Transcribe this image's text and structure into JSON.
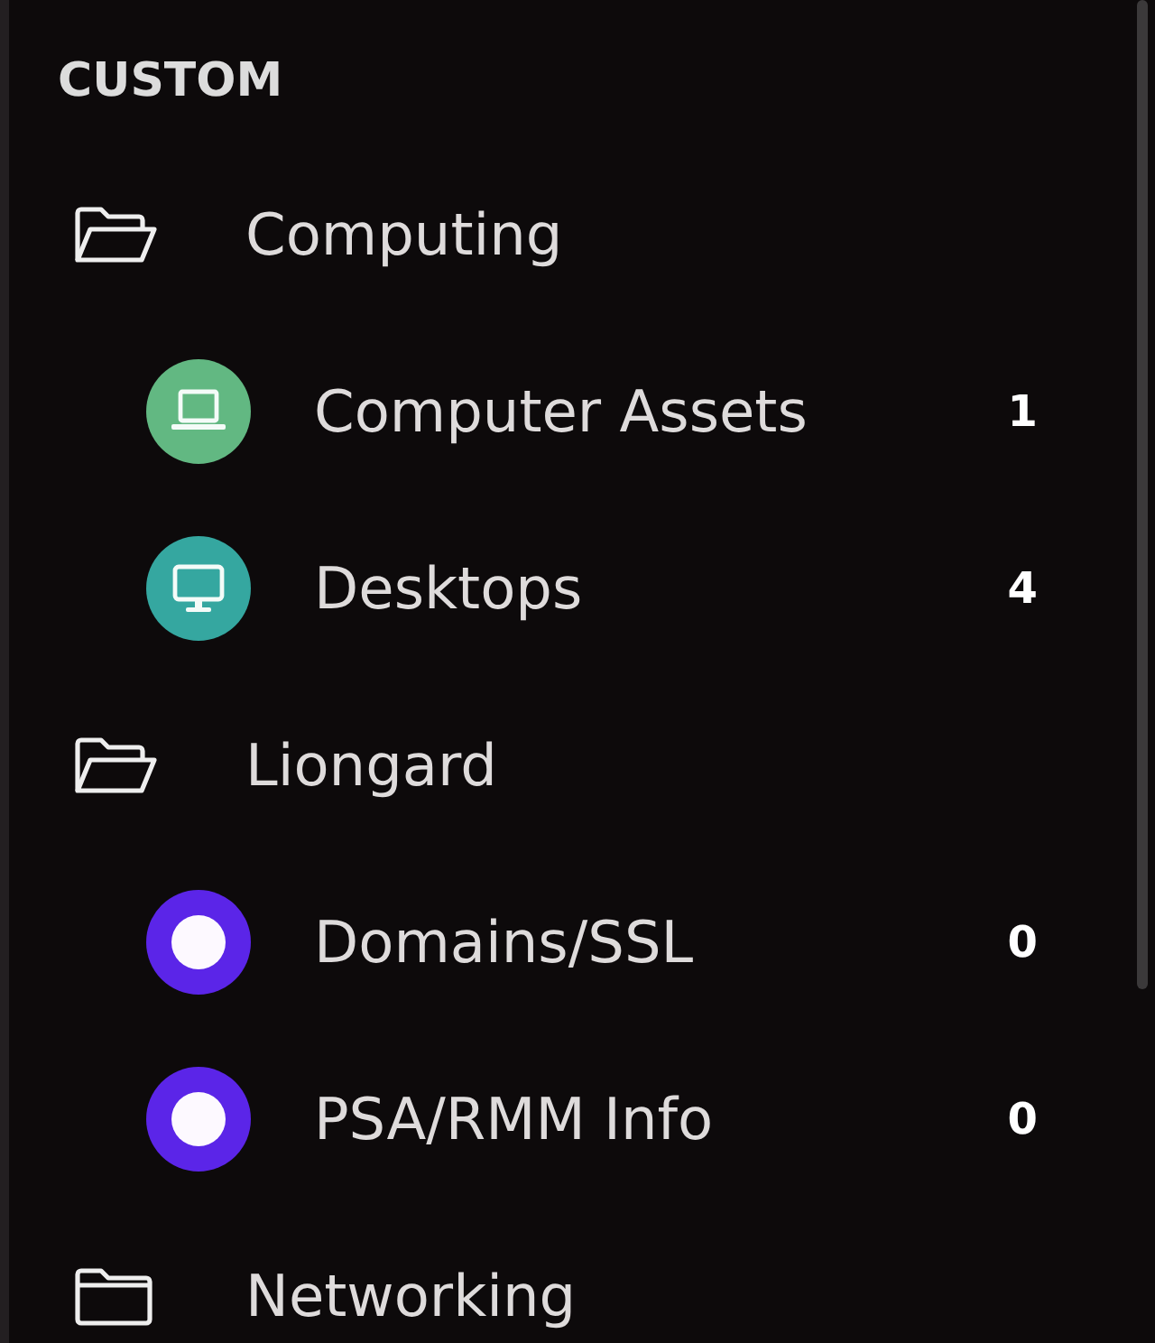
{
  "sidebar": {
    "section_title": "CUSTOM",
    "folders": [
      {
        "name": "Computing",
        "expanded": true,
        "children": [
          {
            "name": "Computer Assets",
            "count": "1",
            "kind": "laptop",
            "color": "#62b882"
          },
          {
            "name": "Desktops",
            "count": "4",
            "kind": "monitor",
            "color": "#35a7a0"
          }
        ]
      },
      {
        "name": "Liongard",
        "expanded": true,
        "children": [
          {
            "name": "Domains/SSL",
            "count": "0",
            "kind": "dot",
            "color": "#5b25e8"
          },
          {
            "name": "PSA/RMM Info",
            "count": "0",
            "kind": "dot",
            "color": "#5b25e8"
          }
        ]
      },
      {
        "name": "Networking",
        "expanded": false
      }
    ]
  }
}
